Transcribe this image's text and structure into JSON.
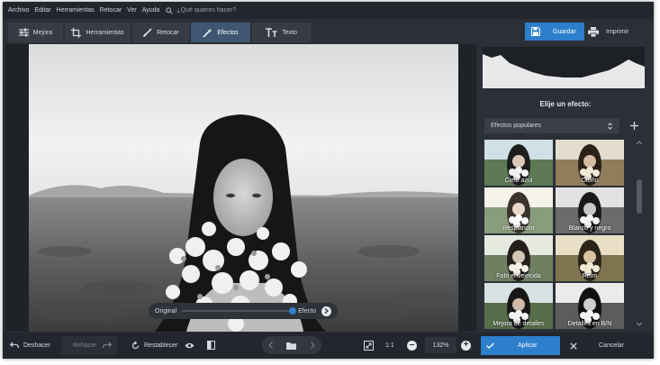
{
  "menu": [
    "Archivo",
    "Editar",
    "Herramientas",
    "Retocar",
    "Ver",
    "Ayuda"
  ],
  "search": {
    "placeholder": "¿Qué quieres hacer?"
  },
  "tabs": [
    {
      "label": "Mejora",
      "icon": "sliders-icon"
    },
    {
      "label": "Herramientas",
      "icon": "crop-icon"
    },
    {
      "label": "Retocar",
      "icon": "brush-icon"
    },
    {
      "label": "Efectos",
      "icon": "magic-wand-icon",
      "active": true
    },
    {
      "label": "Texto",
      "icon": "text-icon"
    }
  ],
  "actions": {
    "save_label": "Guardar",
    "print_label": "Imprimir"
  },
  "compare": {
    "original_label": "Original",
    "effect_label": "Efecto",
    "position": 1.0
  },
  "panel": {
    "title": "Elije un efecto:",
    "category": "Efectos populares",
    "effects": [
      "Cielo azul",
      "Otoño",
      "Resplandor",
      "Blanco y negro",
      "Foto envejecida",
      "Retro",
      "Mejora de detalles",
      "Detalles en B/N"
    ]
  },
  "bottom": {
    "undo_label": "Deshacer",
    "redo_label": "Rehacer",
    "reset_label": "Restablecer",
    "ratio_label": "1:1",
    "zoom": "132%",
    "apply_label": "Aplicar",
    "cancel_label": "Cancelar"
  },
  "colors": {
    "accent": "#2d7fcc",
    "active_tab": "#3e5672",
    "background": "#2b2f36",
    "menubar": "#23272d"
  }
}
